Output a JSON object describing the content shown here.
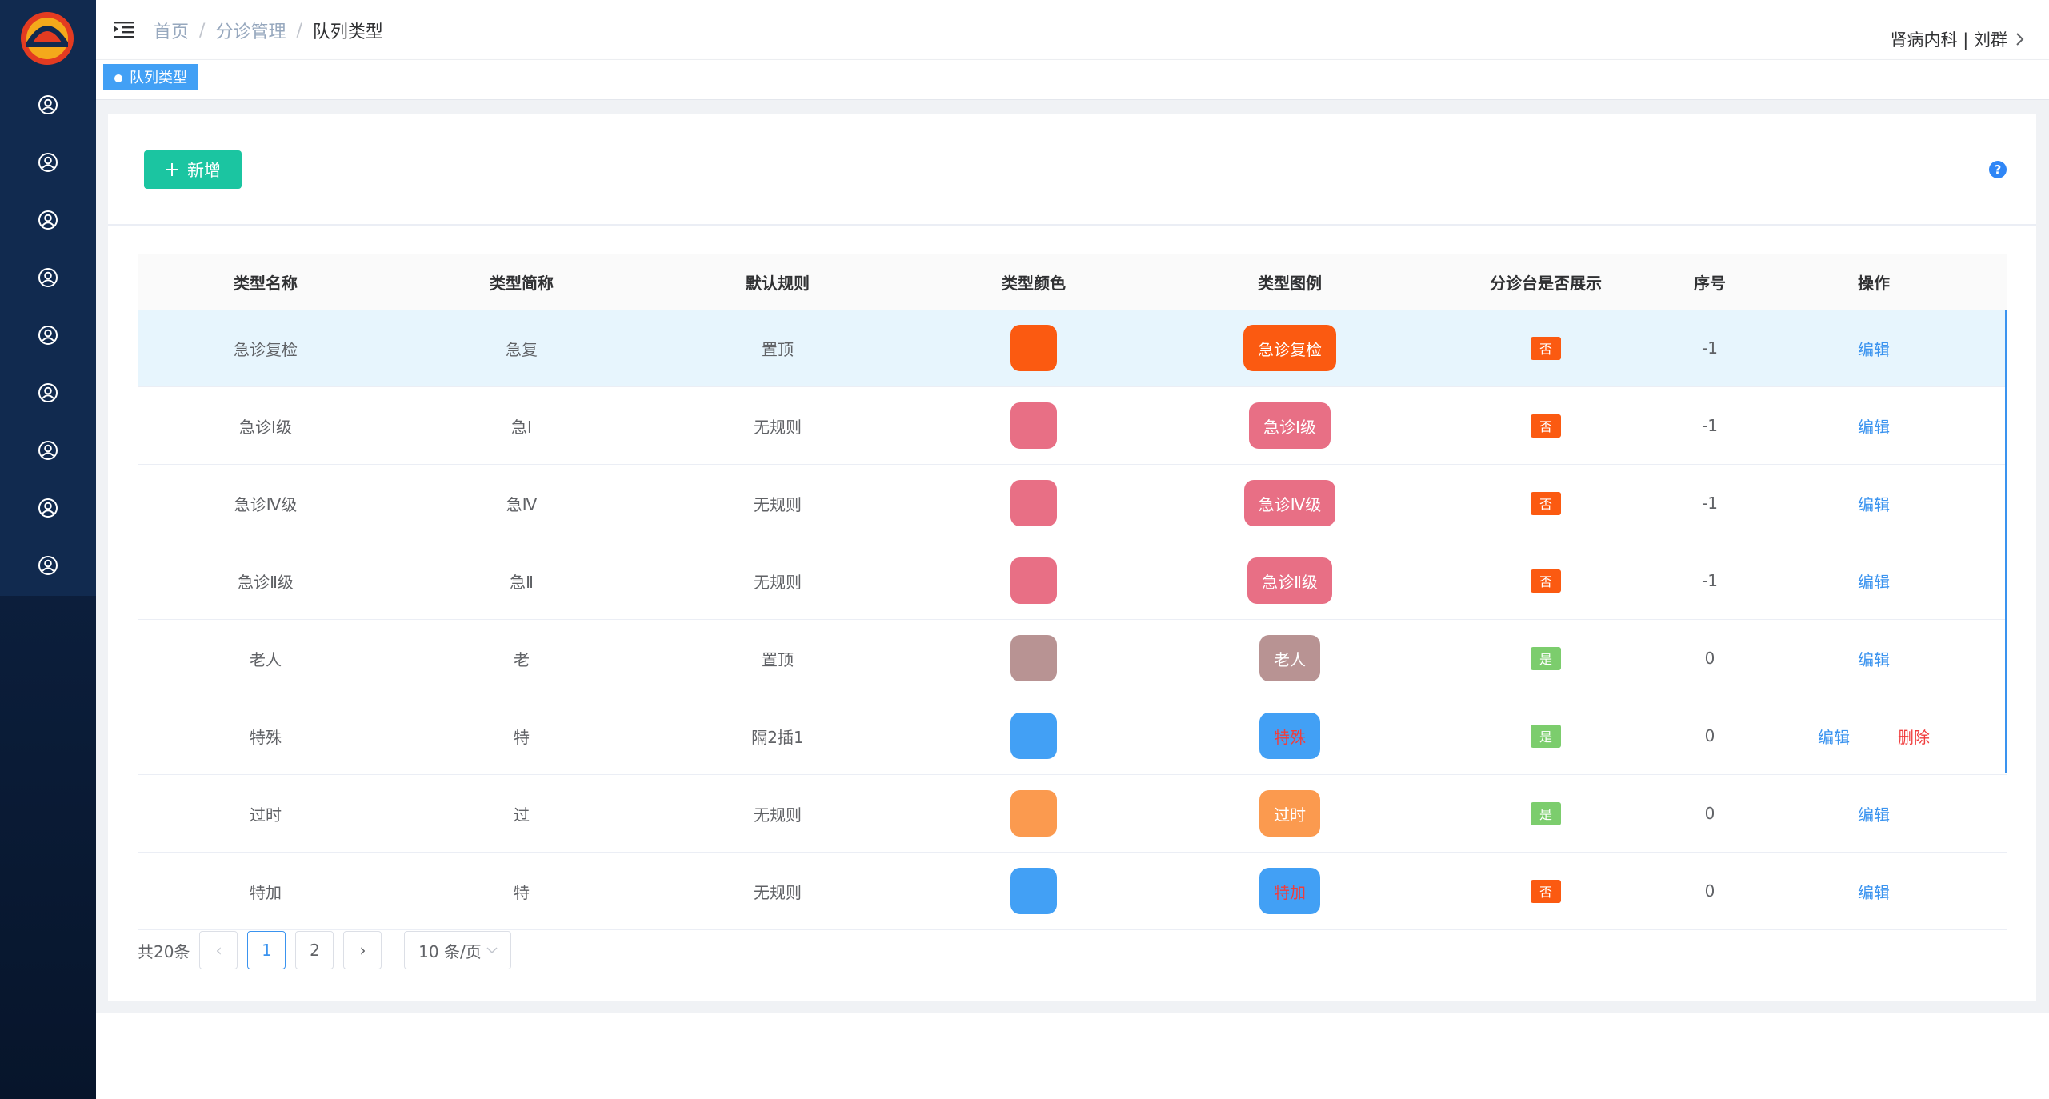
{
  "header": {
    "breadcrumb": [
      "首页",
      "分诊管理",
      "队列类型"
    ],
    "user": "肾病内科 | 刘群"
  },
  "tags": [
    "队列类型"
  ],
  "toolbar": {
    "add_label": "新增",
    "help": "?"
  },
  "table": {
    "columns": [
      "类型名称",
      "类型简称",
      "默认规则",
      "类型颜色",
      "类型图例",
      "分诊台是否展示",
      "序号",
      "操作"
    ],
    "rows": [
      {
        "name": "急诊复检",
        "short": "急复",
        "rule": "置顶",
        "color": "#fb5a11",
        "legend": "急诊复检",
        "legend_text_color": "#ffffff",
        "show": "否",
        "show_color": "#fb5a11",
        "order": "-1",
        "edit": "编辑",
        "delete": ""
      },
      {
        "name": "急诊Ⅰ级",
        "short": "急Ⅰ",
        "rule": "无规则",
        "color": "#e86f85",
        "legend": "急诊Ⅰ级",
        "legend_text_color": "#ffffff",
        "show": "否",
        "show_color": "#fb5a11",
        "order": "-1",
        "edit": "编辑",
        "delete": ""
      },
      {
        "name": "急诊Ⅳ级",
        "short": "急Ⅳ",
        "rule": "无规则",
        "color": "#e86f85",
        "legend": "急诊Ⅳ级",
        "legend_text_color": "#ffffff",
        "show": "否",
        "show_color": "#fb5a11",
        "order": "-1",
        "edit": "编辑",
        "delete": ""
      },
      {
        "name": "急诊Ⅱ级",
        "short": "急Ⅱ",
        "rule": "无规则",
        "color": "#e86f85",
        "legend": "急诊Ⅱ级",
        "legend_text_color": "#ffffff",
        "show": "否",
        "show_color": "#fb5a11",
        "order": "-1",
        "edit": "编辑",
        "delete": ""
      },
      {
        "name": "老人",
        "short": "老",
        "rule": "置顶",
        "color": "#b89393",
        "legend": "老人",
        "legend_text_color": "#ffffff",
        "show": "是",
        "show_color": "#7ccd6d",
        "order": "0",
        "edit": "编辑",
        "delete": ""
      },
      {
        "name": "特殊",
        "short": "特",
        "rule": "隔2插1",
        "color": "#42a0f5",
        "legend": "特殊",
        "legend_text_color": "#f03d3d",
        "show": "是",
        "show_color": "#7ccd6d",
        "order": "0",
        "edit": "编辑",
        "delete": "删除"
      },
      {
        "name": "过时",
        "short": "过",
        "rule": "无规则",
        "color": "#fb9a4f",
        "legend": "过时",
        "legend_text_color": "#ffffff",
        "show": "是",
        "show_color": "#7ccd6d",
        "order": "0",
        "edit": "编辑",
        "delete": ""
      },
      {
        "name": "特加",
        "short": "特",
        "rule": "无规则",
        "color": "#42a0f5",
        "legend": "特加",
        "legend_text_color": "#f03d3d",
        "show": "否",
        "show_color": "#fb5a11",
        "order": "0",
        "edit": "编辑",
        "delete": ""
      }
    ]
  },
  "pagination": {
    "total": "共20条",
    "pages": [
      "1",
      "2"
    ],
    "current": "1",
    "prev": "‹",
    "next": "›",
    "page_size": "10 条/页"
  },
  "colors": {
    "sidebar": "#112a4f",
    "primary": "#3a93ef",
    "add_button": "#1bc5a1"
  }
}
